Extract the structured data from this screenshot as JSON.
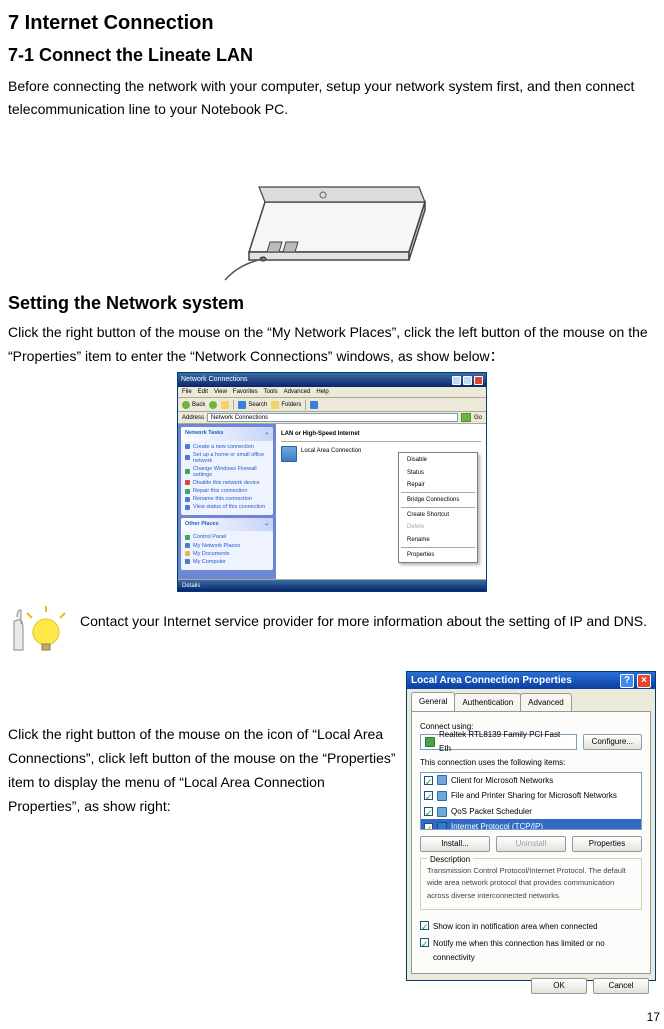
{
  "chapter_title": "7 Internet Connection",
  "section_title": "7-1 Connect the Lineate LAN",
  "intro_paragraph": "Before connecting the network with your computer, setup your network system first, and then connect telecommunication line to your Notebook PC.",
  "subsection_title": "Setting the Network system",
  "setting_paragraph": "Click the right button of the mouse on the “My Network Places”, click the left button of the mouse on the “Properties” item to enter the “Network Connections” windows, as show below：",
  "tip_text": "Contact your Internet service provider for more information about the setting of IP and DNS.",
  "lac_paragraph": "Click the right button of the mouse on the icon of “Local Area Connections”, click left button of the mouse on the “Properties” item to display the menu of “Local Area Connection Properties”, as show right:",
  "nc": {
    "title": "Network Connections",
    "menus": [
      "File",
      "Edit",
      "View",
      "Favorites",
      "Tools",
      "Advanced",
      "Help"
    ],
    "toolbar": {
      "back": "Back",
      "search": "Search",
      "folders": "Folders"
    },
    "address_label": "Address",
    "address_value": "Network Connections",
    "go": "Go",
    "panel1_head": "Network Tasks",
    "panel1_items": [
      "Create a new connection",
      "Set up a home or small office network",
      "Change Windows Firewall settings",
      "Disable this network device",
      "Repair this connection",
      "Rename this connection",
      "View status of this connection"
    ],
    "panel2_head": "Other Places",
    "panel2_items": [
      "Control Panel",
      "My Network Places",
      "My Documents",
      "My Computer"
    ],
    "group_head": "LAN or High-Speed Internet",
    "conn_name": "Local Area Connection",
    "ctx_items": [
      "Disable",
      "Status",
      "Repair",
      "",
      "Bridge Connections",
      "",
      "Create Shortcut",
      "Delete",
      "Rename",
      "",
      "Properties"
    ],
    "status_bar": "Details"
  },
  "lac": {
    "title": "Local Area Connection Properties",
    "help": "?",
    "close": "×",
    "tabs": [
      "General",
      "Authentication",
      "Advanced"
    ],
    "connect_using": "Connect using:",
    "nic": "Realtek RTL8139 Family PCI Fast Eth",
    "configure": "Configure...",
    "uses_label": "This connection uses the following items:",
    "items": [
      "Client for Microsoft Networks",
      "File and Printer Sharing for Microsoft Networks",
      "QoS Packet Scheduler",
      "Internet Protocol (TCP/IP)"
    ],
    "install": "Install...",
    "uninstall": "Uninstall",
    "properties": "Properties",
    "desc_head": "Description",
    "desc_body": "Transmission Control Protocol/Internet Protocol. The default wide area network protocol that provides communication across diverse interconnected networks.",
    "chk1": "Show icon in notification area when connected",
    "chk2": "Notify me when this connection has limited or no connectivity",
    "ok": "OK",
    "cancel": "Cancel"
  },
  "page_number": "17"
}
